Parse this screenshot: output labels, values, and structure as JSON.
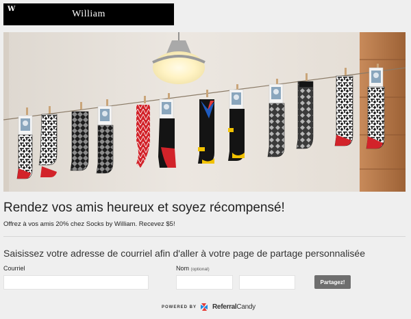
{
  "brand": {
    "logo_mark": "W",
    "logo_text": "William"
  },
  "hero": {
    "image": "hanging-socks-photo",
    "colors": {
      "wall": "#e8e2db",
      "wood": "#b77a4c",
      "lamp": "#a9a9a9",
      "sock_red": "#d2232a",
      "sock_black": "#141414",
      "sock_yellow": "#f2c200",
      "sock_blue": "#1e5bbf"
    }
  },
  "content": {
    "headline": "Rendez vos amis heureux et soyez récompensé!",
    "subline": "Offrez à vos amis 20% chez Socks by William. Recevez $5!",
    "prompt": "Saisissez votre adresse de courriel afin d'aller à votre page de partage personnalisée"
  },
  "form": {
    "email_label": "Courriel",
    "email_value": "",
    "name_label": "Nom",
    "name_optional": "(optional)",
    "first_name_value": "",
    "last_name_value": "",
    "submit_label": "Partagez!"
  },
  "footer": {
    "powered_by": "POWERED BY",
    "brand_part1": "Referral",
    "brand_part2": "Candy",
    "icon": "referralcandy-logo-icon"
  }
}
